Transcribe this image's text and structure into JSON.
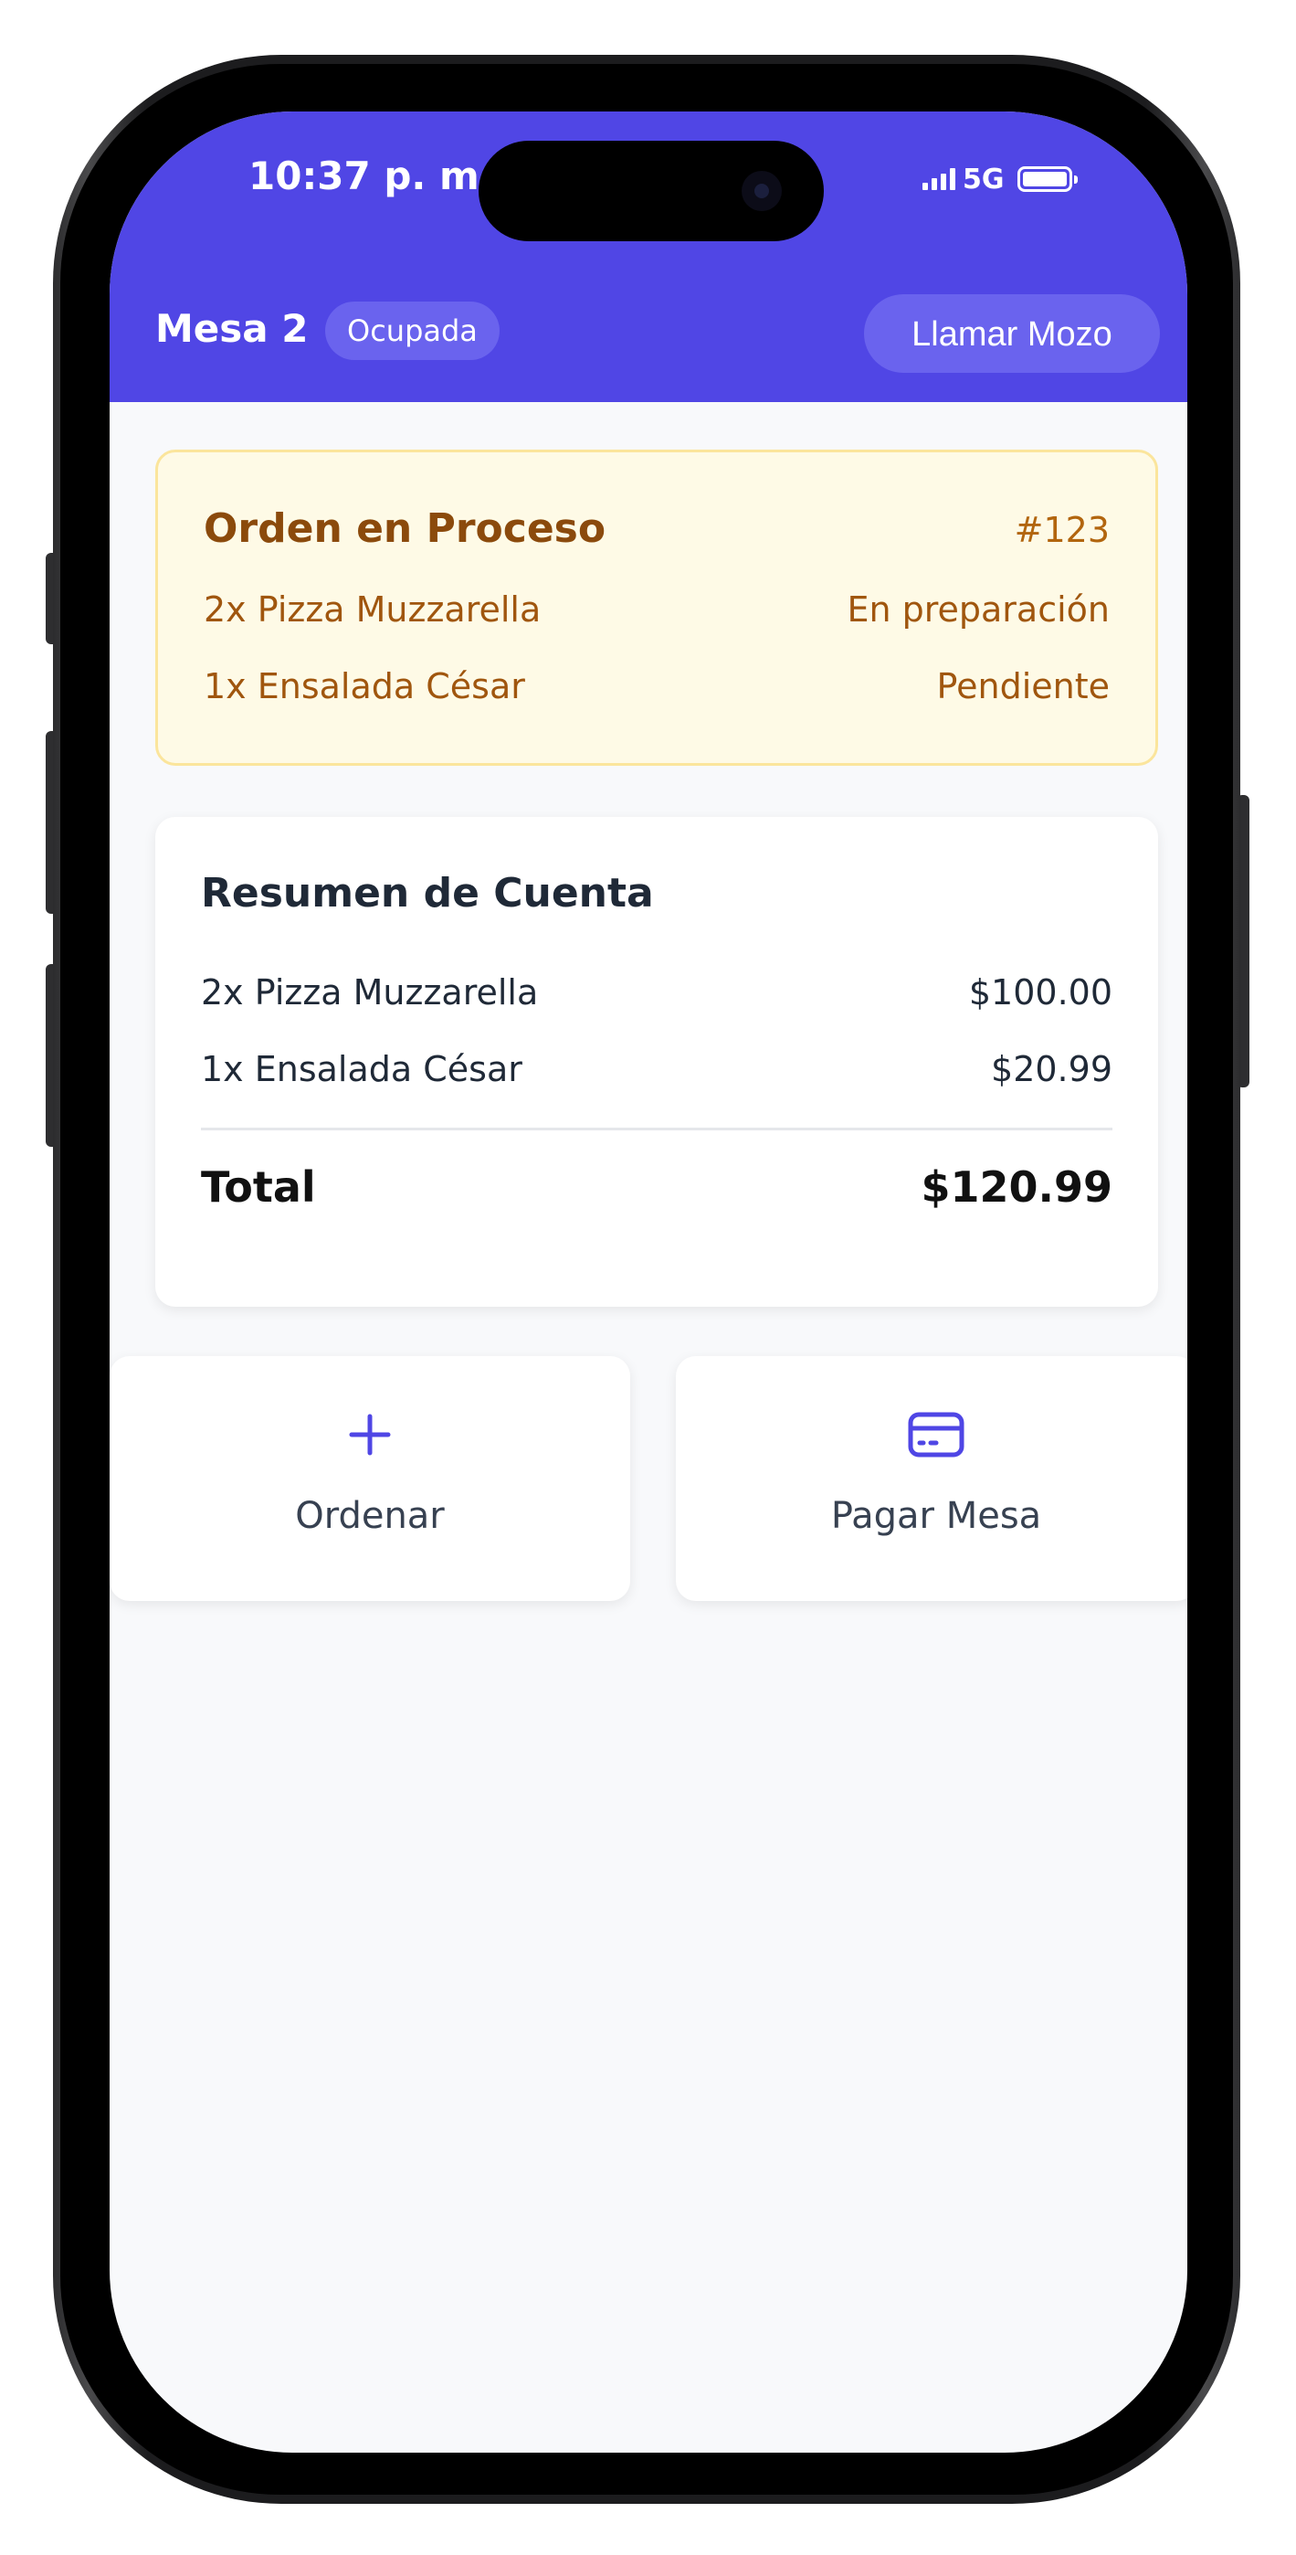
{
  "status_bar": {
    "time": "10:37 p. m.",
    "network": "5G"
  },
  "header": {
    "table_name": "Mesa 2",
    "table_status": "Ocupada",
    "call_waiter_label": "Llamar Mozo"
  },
  "order_in_process": {
    "title": "Orden en Proceso",
    "number": "#123",
    "items": [
      {
        "name": "2x Pizza Muzzarella",
        "status": "En preparación"
      },
      {
        "name": "1x Ensalada César",
        "status": "Pendiente"
      }
    ]
  },
  "account_summary": {
    "title": "Resumen de Cuenta",
    "items": [
      {
        "name": "2x Pizza Muzzarella",
        "price": "$100.00"
      },
      {
        "name": "1x Ensalada César",
        "price": "$20.99"
      }
    ],
    "total_label": "Total",
    "total_value": "$120.99"
  },
  "actions": {
    "order_label": "Ordenar",
    "order_icon": "plus-icon",
    "pay_label": "Pagar Mesa",
    "pay_icon": "credit-card-icon"
  },
  "colors": {
    "header_bg": "#5046e5",
    "accent": "#4f46e5",
    "order_card_bg": "#fefae6",
    "order_card_border": "#fbe59c",
    "order_text": "#a0560e",
    "page_bg": "#f8f9fb"
  }
}
